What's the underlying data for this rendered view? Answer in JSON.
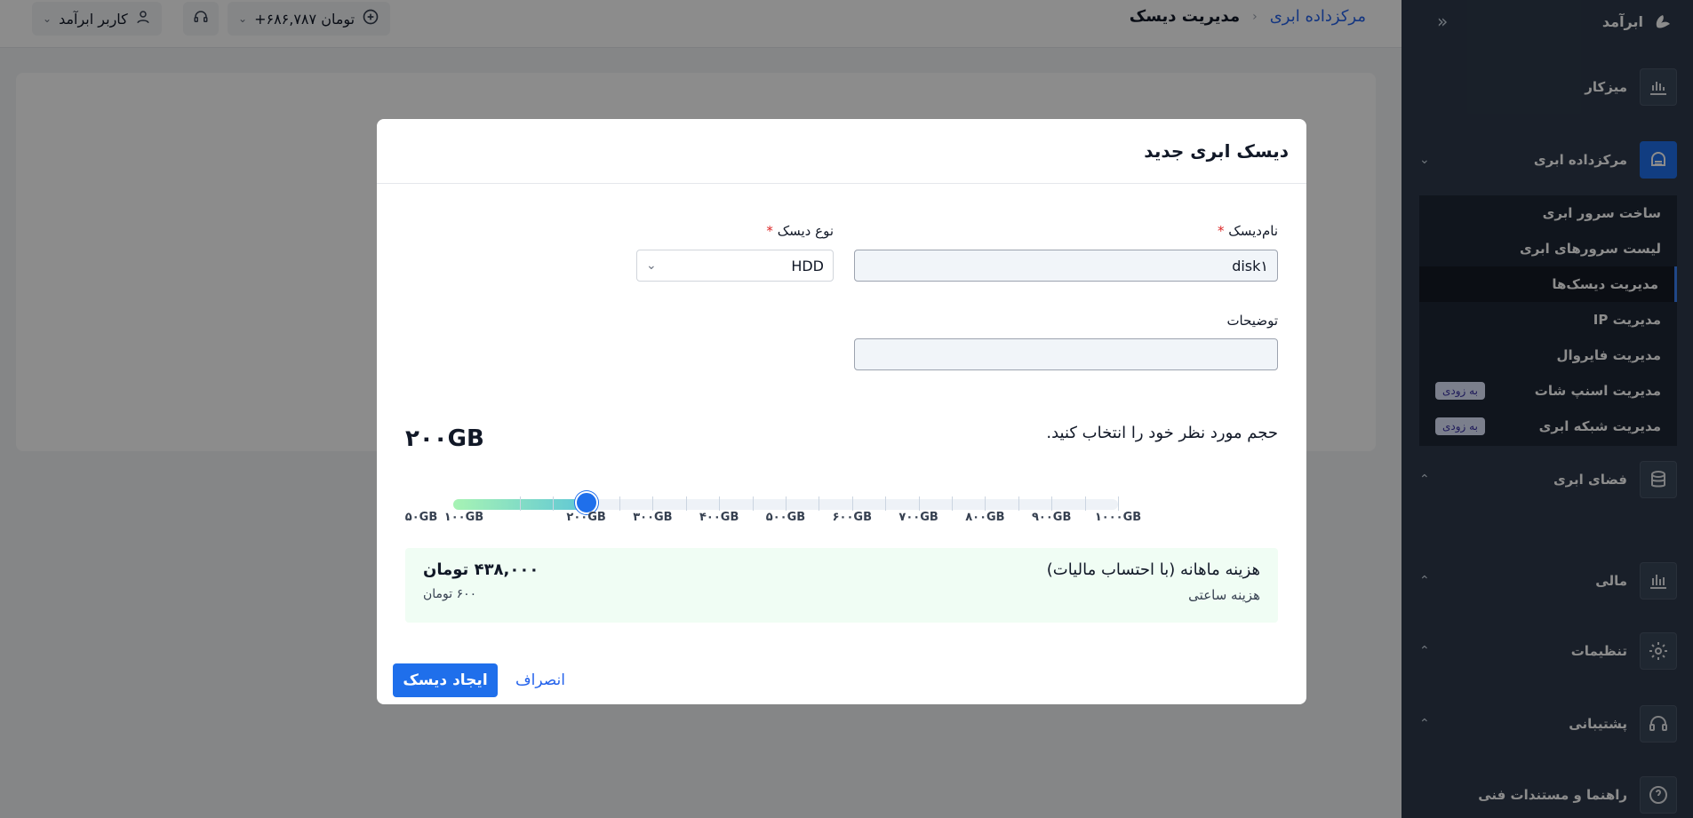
{
  "topbar": {
    "breadcrumb_parent": "مرکزداده ابری",
    "breadcrumb_current": "مدیریت دیسک",
    "user_label": "کاربر ابرآمد",
    "balance": "+۶۸۶,۷۸۷ تومان"
  },
  "sidebar": {
    "brand": "ابرآمد",
    "items": {
      "dashboard": "میزکار",
      "datacenter": "مرکزداده ابری",
      "cloud_space": "فضای ابری",
      "finance": "مالی",
      "settings": "تنظیمات",
      "support": "پشتیبانی",
      "docs": "راهنما و مستندات فنی"
    },
    "sub_items": [
      {
        "label": "ساخت سرور ابری",
        "badge": ""
      },
      {
        "label": "لیست سرورهای ابری",
        "badge": ""
      },
      {
        "label": "مدیریت دیسک‌ها",
        "badge": ""
      },
      {
        "label": "مدیریت IP",
        "badge": ""
      },
      {
        "label": "مدیریت فایروال",
        "badge": ""
      },
      {
        "label": "مدیریت اسنپ شات",
        "badge": "به زودی"
      },
      {
        "label": "مدیریت شبکه ابری",
        "badge": "به زودی"
      }
    ]
  },
  "modal": {
    "title": "دیسک ابری جدید",
    "disk_name_label": "نام‌دیسک",
    "disk_name_value": "disk۱",
    "disk_type_label": "نوع دیسک",
    "disk_type_value": "HDD",
    "description_label": "توضیحات",
    "description_value": "",
    "size_prompt": "حجم مورد نظر خود را انتخاب کنید.",
    "size_value": "۲۰۰GB",
    "slider": {
      "min": 50,
      "max": 1000,
      "value": 200,
      "tick_labels": [
        "۵۰GB",
        "۱۰۰GB",
        "۲۰۰GB",
        "۳۰۰GB",
        "۴۰۰GB",
        "۵۰۰GB",
        "۶۰۰GB",
        "۷۰۰GB",
        "۸۰۰GB",
        "۹۰۰GB",
        "۱۰۰۰GB"
      ]
    },
    "monthly_cost_label": "هزینه ماهانه (با احتساب مالیات)",
    "monthly_cost_value": "۴۳۸,۰۰۰ تومان",
    "hourly_cost_label": "هزینه ساعتی",
    "hourly_cost_value": "۶۰۰ تومان",
    "submit_label": "ایجاد دیسک",
    "cancel_label": "انصراف"
  },
  "colors": {
    "primary": "#1f6feb",
    "sidebar_bg": "#2e3a4b",
    "cost_box_bg": "#f0fdf4"
  }
}
